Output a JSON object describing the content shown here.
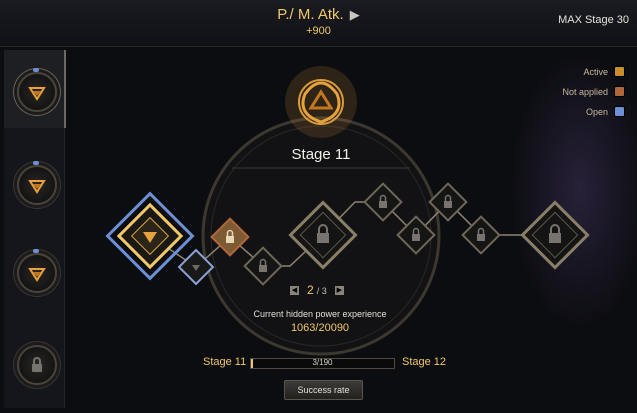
{
  "header": {
    "stat_name": "P./ M. Atk.",
    "stat_value": "+900",
    "max_stage": "MAX Stage 30"
  },
  "legend": [
    {
      "label": "Active",
      "color": "#c98f2a"
    },
    {
      "label": "Not applied",
      "color": "#b0673a"
    },
    {
      "label": "Open",
      "color": "#6d8fd4"
    }
  ],
  "sidebar": {
    "slots": [
      {
        "state": "unlocked",
        "selected": true,
        "icon": "celtic-knot-icon"
      },
      {
        "state": "unlocked",
        "selected": false,
        "icon": "celtic-knot-icon"
      },
      {
        "state": "unlocked",
        "selected": false,
        "icon": "celtic-knot-icon"
      },
      {
        "state": "locked",
        "selected": false,
        "icon": "lock-icon"
      }
    ]
  },
  "panel": {
    "stage_title": "Stage 11",
    "emblem_icon": "celtic-knot-icon",
    "page_current": "2",
    "page_total": "/ 3",
    "prev_icon": "left-arrow-icon",
    "next_icon": "right-arrow-icon",
    "exp_label": "Current hidden power experience",
    "exp_value": "1063/20090"
  },
  "progress": {
    "from_stage": "Stage 11",
    "to_stage": "Stage 12",
    "text": "3/190",
    "fraction": 0.016
  },
  "success_button": "Success rate"
}
